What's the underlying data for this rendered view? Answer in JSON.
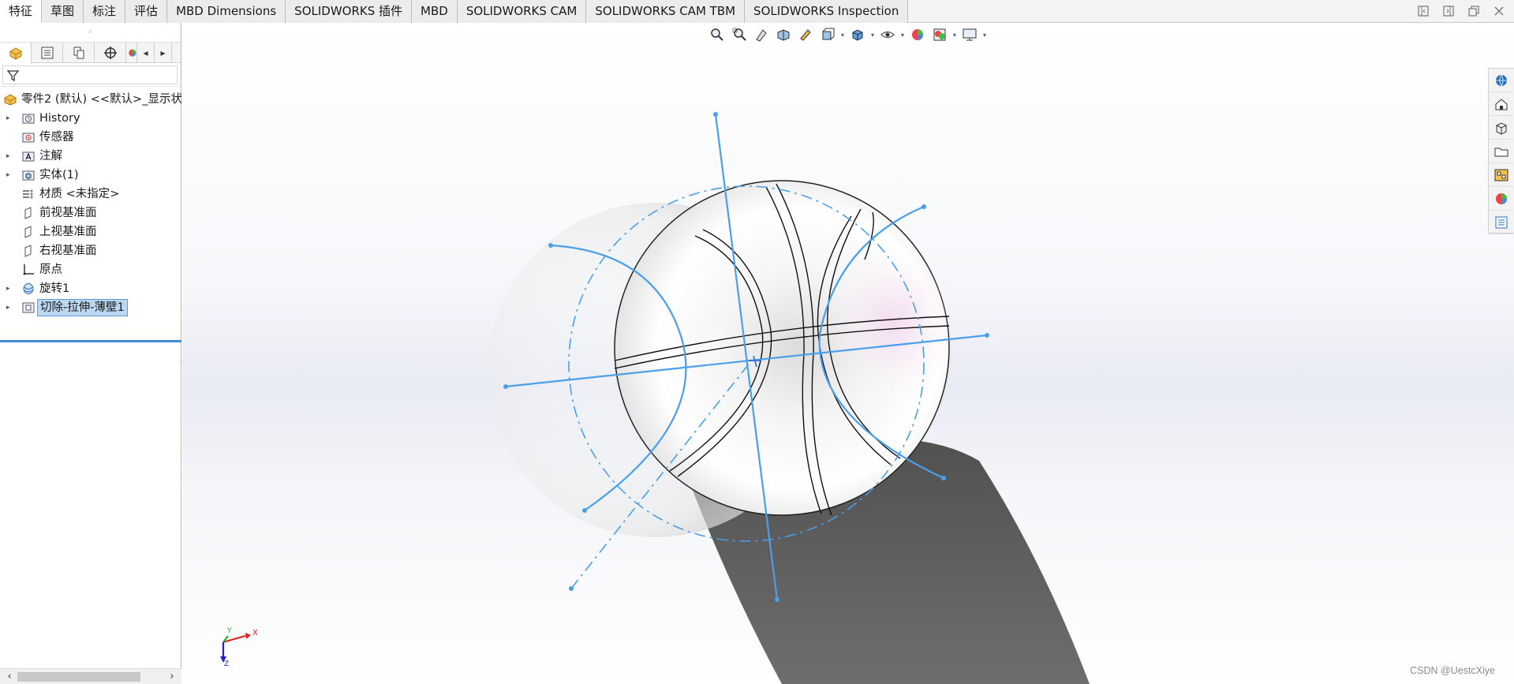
{
  "tabs": [
    {
      "label": "特征",
      "active": true
    },
    {
      "label": "草图",
      "active": false
    },
    {
      "label": "标注",
      "active": false
    },
    {
      "label": "评估",
      "active": false
    },
    {
      "label": "MBD Dimensions",
      "active": false
    },
    {
      "label": "SOLIDWORKS 插件",
      "active": false
    },
    {
      "label": "MBD",
      "active": false
    },
    {
      "label": "SOLIDWORKS CAM",
      "active": false
    },
    {
      "label": "SOLIDWORKS CAM TBM",
      "active": false
    },
    {
      "label": "SOLIDWORKS Inspection",
      "active": false
    }
  ],
  "panel": {
    "collapse_glyph": "◦",
    "prev_glyph": "◂",
    "next_glyph": "▸",
    "splitter_glyph": "◦"
  },
  "tree": {
    "root": "零件2 (默认) <<默认>_显示状",
    "items": [
      {
        "label": "History",
        "expandable": true,
        "icon": "history-folder-icon"
      },
      {
        "label": "传感器",
        "expandable": false,
        "icon": "sensor-icon"
      },
      {
        "label": "注解",
        "expandable": true,
        "icon": "annotation-icon"
      },
      {
        "label": "实体(1)",
        "expandable": true,
        "icon": "solid-bodies-icon"
      },
      {
        "label": "材质 <未指定>",
        "expandable": false,
        "icon": "material-icon"
      },
      {
        "label": "前视基准面",
        "expandable": false,
        "icon": "plane-icon"
      },
      {
        "label": "上视基准面",
        "expandable": false,
        "icon": "plane-icon"
      },
      {
        "label": "右视基准面",
        "expandable": false,
        "icon": "plane-icon"
      },
      {
        "label": "原点",
        "expandable": false,
        "icon": "origin-icon"
      },
      {
        "label": "旋转1",
        "expandable": true,
        "icon": "revolve-icon"
      },
      {
        "label": "切除-拉伸-薄壁1",
        "expandable": true,
        "icon": "cut-extrude-icon",
        "selected": true
      }
    ]
  },
  "scroll": {
    "left_glyph": "‹",
    "right_glyph": "›"
  },
  "triad": {
    "x": "X",
    "y": "Y",
    "z": "Z"
  },
  "watermark": "CSDN @UestcXiye",
  "colors": {
    "sketch_blue": "#4a9fea",
    "selection_blue": "#bcd7f2",
    "tree_end_line": "#3d8bd1"
  }
}
